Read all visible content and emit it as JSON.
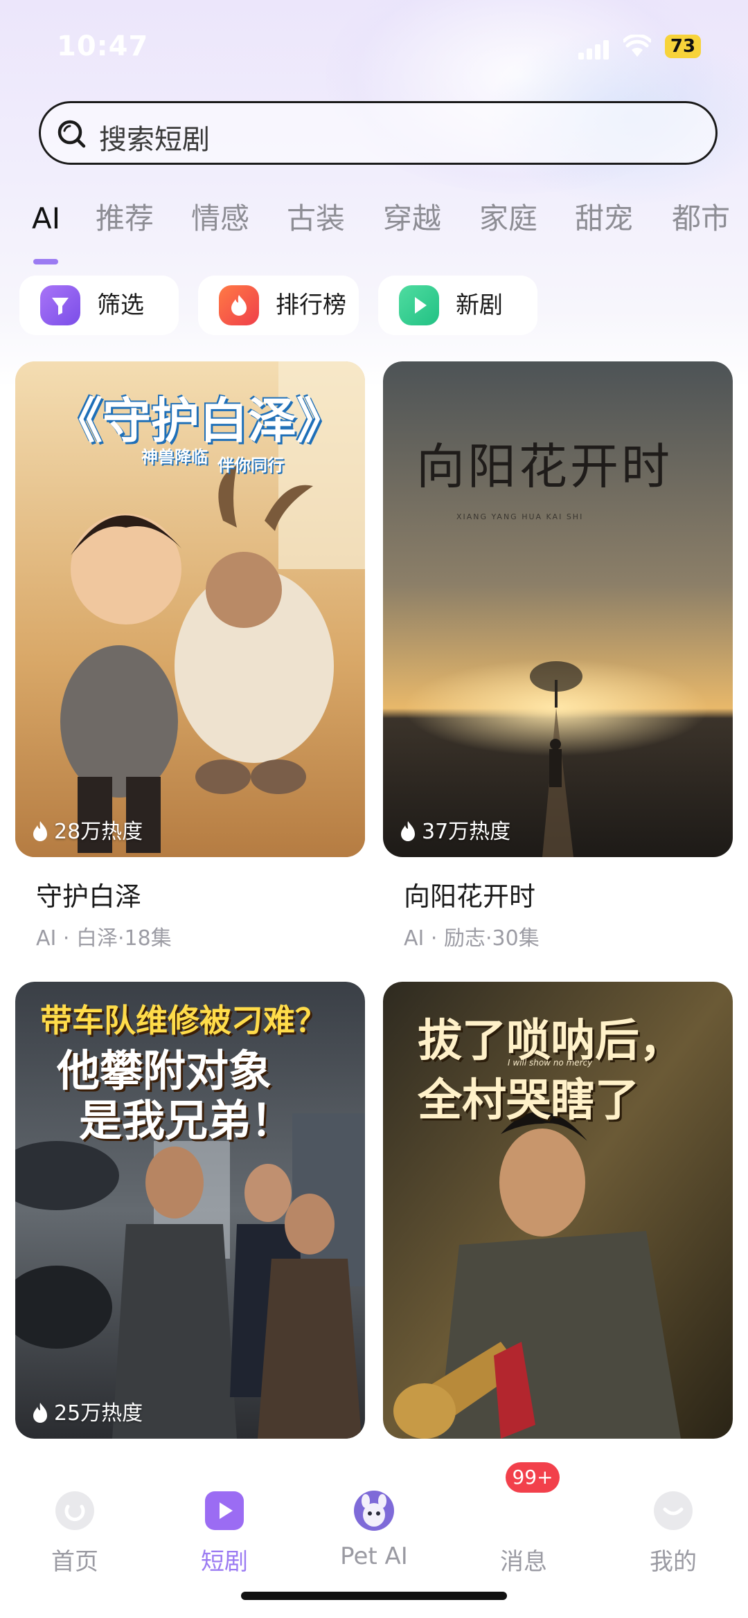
{
  "status_bar": {
    "time": "10:47",
    "battery": "73"
  },
  "search": {
    "placeholder": "搜索短剧"
  },
  "tabs": [
    "AI",
    "推荐",
    "情感",
    "古装",
    "穿越",
    "家庭",
    "甜宠",
    "都市"
  ],
  "active_tab": "AI",
  "quick_buttons": [
    {
      "label": "筛选",
      "icon": "filter-icon",
      "color": "#8b5cf6"
    },
    {
      "label": "排行榜",
      "icon": "flame-icon",
      "color": "#f0563f"
    },
    {
      "label": "新剧",
      "icon": "play-icon",
      "color": "#2fc98c"
    }
  ],
  "cards": [
    {
      "title": "守护白泽",
      "meta": "AI · 白泽·18集",
      "heat": "28万热度",
      "poster_title": "《守护白泽》",
      "poster_subtitle_1": "神兽降临",
      "poster_subtitle_2": "伴你同行"
    },
    {
      "title": "向阳花开时",
      "meta": "AI · 励志·30集",
      "heat": "37万热度",
      "poster_title": "向阳花开时",
      "poster_subtitle_1": "XIANG YANG HUA KAI SHI"
    },
    {
      "heat": "25万热度",
      "poster_line_1": "带车队维修被刁难？",
      "poster_line_2": "他攀附对象",
      "poster_line_3": "是我兄弟！"
    },
    {
      "poster_line_1": "拔了唢呐后，",
      "poster_line_2": "I will show no mercy",
      "poster_line_3": "全村哭瞎了"
    }
  ],
  "bottom_nav": [
    {
      "label": "首页",
      "icon": "home-icon"
    },
    {
      "label": "短剧",
      "icon": "play-icon"
    },
    {
      "label": "Pet AI",
      "icon": "pet-avatar-icon"
    },
    {
      "label": "消息",
      "icon": "message-icon"
    },
    {
      "label": "我的",
      "icon": "profile-icon"
    }
  ],
  "active_nav": "短剧",
  "message_badge": "99+",
  "colors": {
    "accent": "#9b7bf2",
    "badge": "#f2404b",
    "battery": "#f7d33a"
  }
}
